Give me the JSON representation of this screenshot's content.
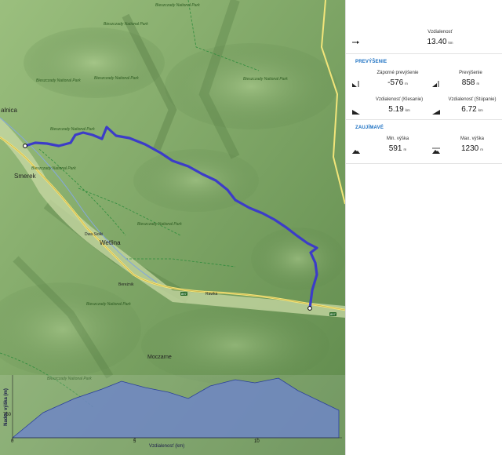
{
  "map": {
    "places": {
      "smerek": "Smerek",
      "wetlina": "Wetlina",
      "moczarne": "Moczarne",
      "kalnica": "alnica",
      "dwa_sady": "Dwa Siołki",
      "beskidnik": "Bereżnik",
      "rawka": "Rawka"
    },
    "park_label": "Bieszczady National Park",
    "road_number": "897"
  },
  "profile": {
    "y_axis_title": "Nadm. výška (m)",
    "x_axis_title": "Vzdialenosť (km)",
    "y_tick": "750",
    "x_ticks": [
      "0",
      "5",
      "10"
    ]
  },
  "panel": {
    "distance": {
      "label": "Vzdialenosť",
      "value": "13.40",
      "unit": "km",
      "icon": "arrow-right-icon"
    },
    "elevation_title": "PREVÝŠENIE",
    "descent": {
      "label": "Záporné prevýšenie",
      "value": "-576",
      "unit": "m",
      "icon": "descent-icon"
    },
    "ascent": {
      "label": "Prevýšenie",
      "value": "858",
      "unit": "m",
      "icon": "ascent-icon"
    },
    "descent_distance": {
      "label": "Vzdialenosť (Klesanie)",
      "value": "5.19",
      "unit": "km",
      "icon": "descent-slope-icon"
    },
    "ascent_distance": {
      "label": "Vzdialenosť (Stúpanie)",
      "value": "6.72",
      "unit": "km",
      "icon": "ascent-slope-icon"
    },
    "interesting_title": "ZAUJÍMAVÉ",
    "min_elev": {
      "label": "Min. výška",
      "value": "591",
      "unit": "m",
      "icon": "min-elevation-icon"
    },
    "max_elev": {
      "label": "Max. výška",
      "value": "1230",
      "unit": "m",
      "icon": "max-elevation-icon"
    }
  },
  "colors": {
    "route": "#3c3cc8",
    "forest": "#7fa866",
    "accent": "#1a6fc2",
    "profile_fill": "#6f86c6"
  }
}
